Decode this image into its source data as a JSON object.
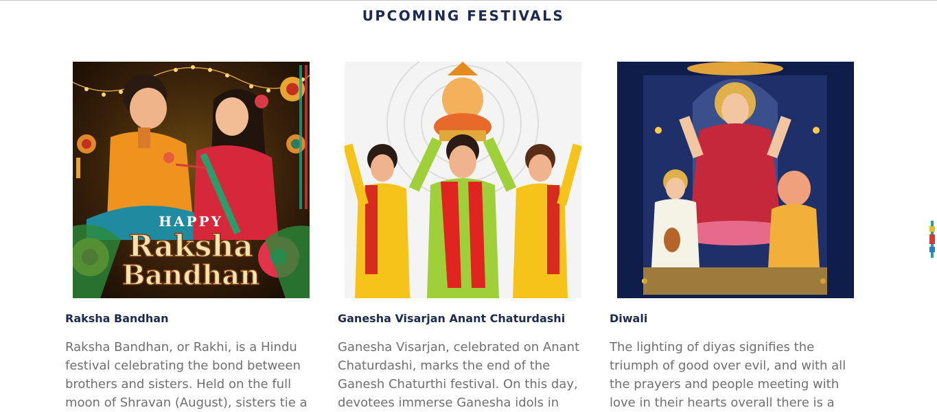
{
  "section": {
    "title": "UPCOMING FESTIVALS"
  },
  "festivals": [
    {
      "title": "Raksha Bandhan",
      "image_caption": [
        "HAPPY",
        "Raksha",
        "Bandhan"
      ],
      "description": "Raksha Bandhan, or Rakhi, is a Hindu festival celebrating the bond between brothers and sisters. Held on the full moon of Shravan (August), sisters tie a"
    },
    {
      "title": "Ganesha Visarjan Anant Chaturdashi",
      "description": "Ganesha Visarjan, celebrated on Anant Chaturdashi, marks the end of the Ganesh Chaturthi festival. On this day, devotees immerse Ganesha idols in"
    },
    {
      "title": "Diwali",
      "description": "The lighting of diyas signifies the triumph of good over evil, and with all the prayers and people meeting with love in their hearts overall there is a"
    }
  ],
  "colors": {
    "heading": "#1b2a4e",
    "body_text": "#6f6f6f",
    "diwali_bg": "#0f1d4a"
  },
  "side_widget": {
    "icon": "rakhi-decoration-icon"
  }
}
